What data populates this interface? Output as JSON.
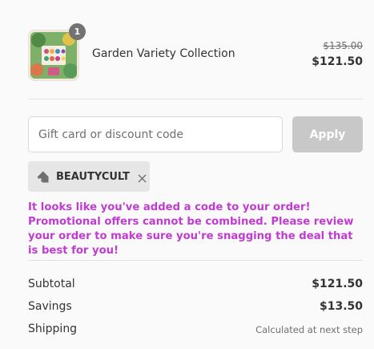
{
  "cart": {
    "item": {
      "name": "Garden Variety Collection",
      "quantity": "1",
      "original_price": "$135.00",
      "price": "$121.50"
    }
  },
  "discount": {
    "placeholder": "Gift card or discount code",
    "apply_label": "Apply",
    "applied_code": "BEAUTYCULT",
    "message": "It looks like you've added a code to your order! Promotional offers cannot be combined. Please review your order to make sure you're snagging the deal that is best for you!"
  },
  "summary": {
    "subtotal_label": "Subtotal",
    "subtotal_value": "$121.50",
    "savings_label": "Savings",
    "savings_value": "$13.50",
    "shipping_label": "Shipping",
    "shipping_value": "Calculated at next step"
  },
  "colors": {
    "promo_message": "#c03cd1",
    "apply_button_disabled": "#c8c8c8",
    "chip_background": "#e6e6e6",
    "badge": "#737373"
  },
  "icons": {
    "tag": "tag-icon",
    "remove": "close-icon"
  }
}
